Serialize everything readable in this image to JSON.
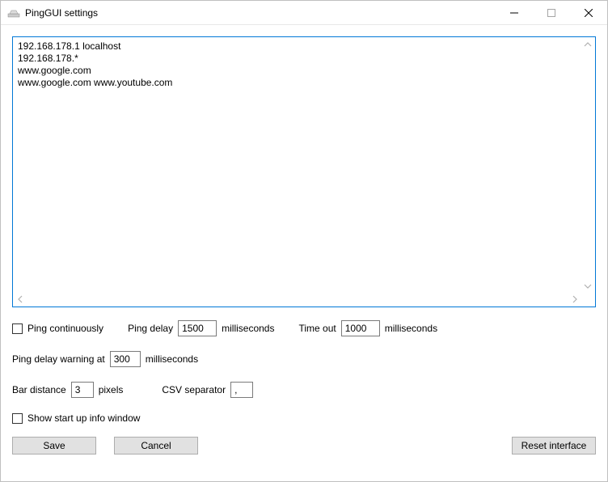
{
  "window": {
    "title": "PingGUI settings"
  },
  "hosts_text": "192.168.178.1 localhost\n192.168.178.*\nwww.google.com\nwww.google.com www.youtube.com",
  "labels": {
    "ping_continuously": "Ping continuously",
    "ping_delay": "Ping delay",
    "milliseconds": "milliseconds",
    "time_out": "Time out",
    "ping_delay_warning_at": "Ping delay warning at",
    "bar_distance": "Bar distance",
    "pixels": "pixels",
    "csv_separator": "CSV separator",
    "show_startup_info": "Show start up info window"
  },
  "values": {
    "ping_delay": "1500",
    "time_out": "1000",
    "ping_delay_warning": "300",
    "bar_distance": "3",
    "csv_separator": ","
  },
  "buttons": {
    "save": "Save",
    "cancel": "Cancel",
    "reset_interface": "Reset interface"
  }
}
